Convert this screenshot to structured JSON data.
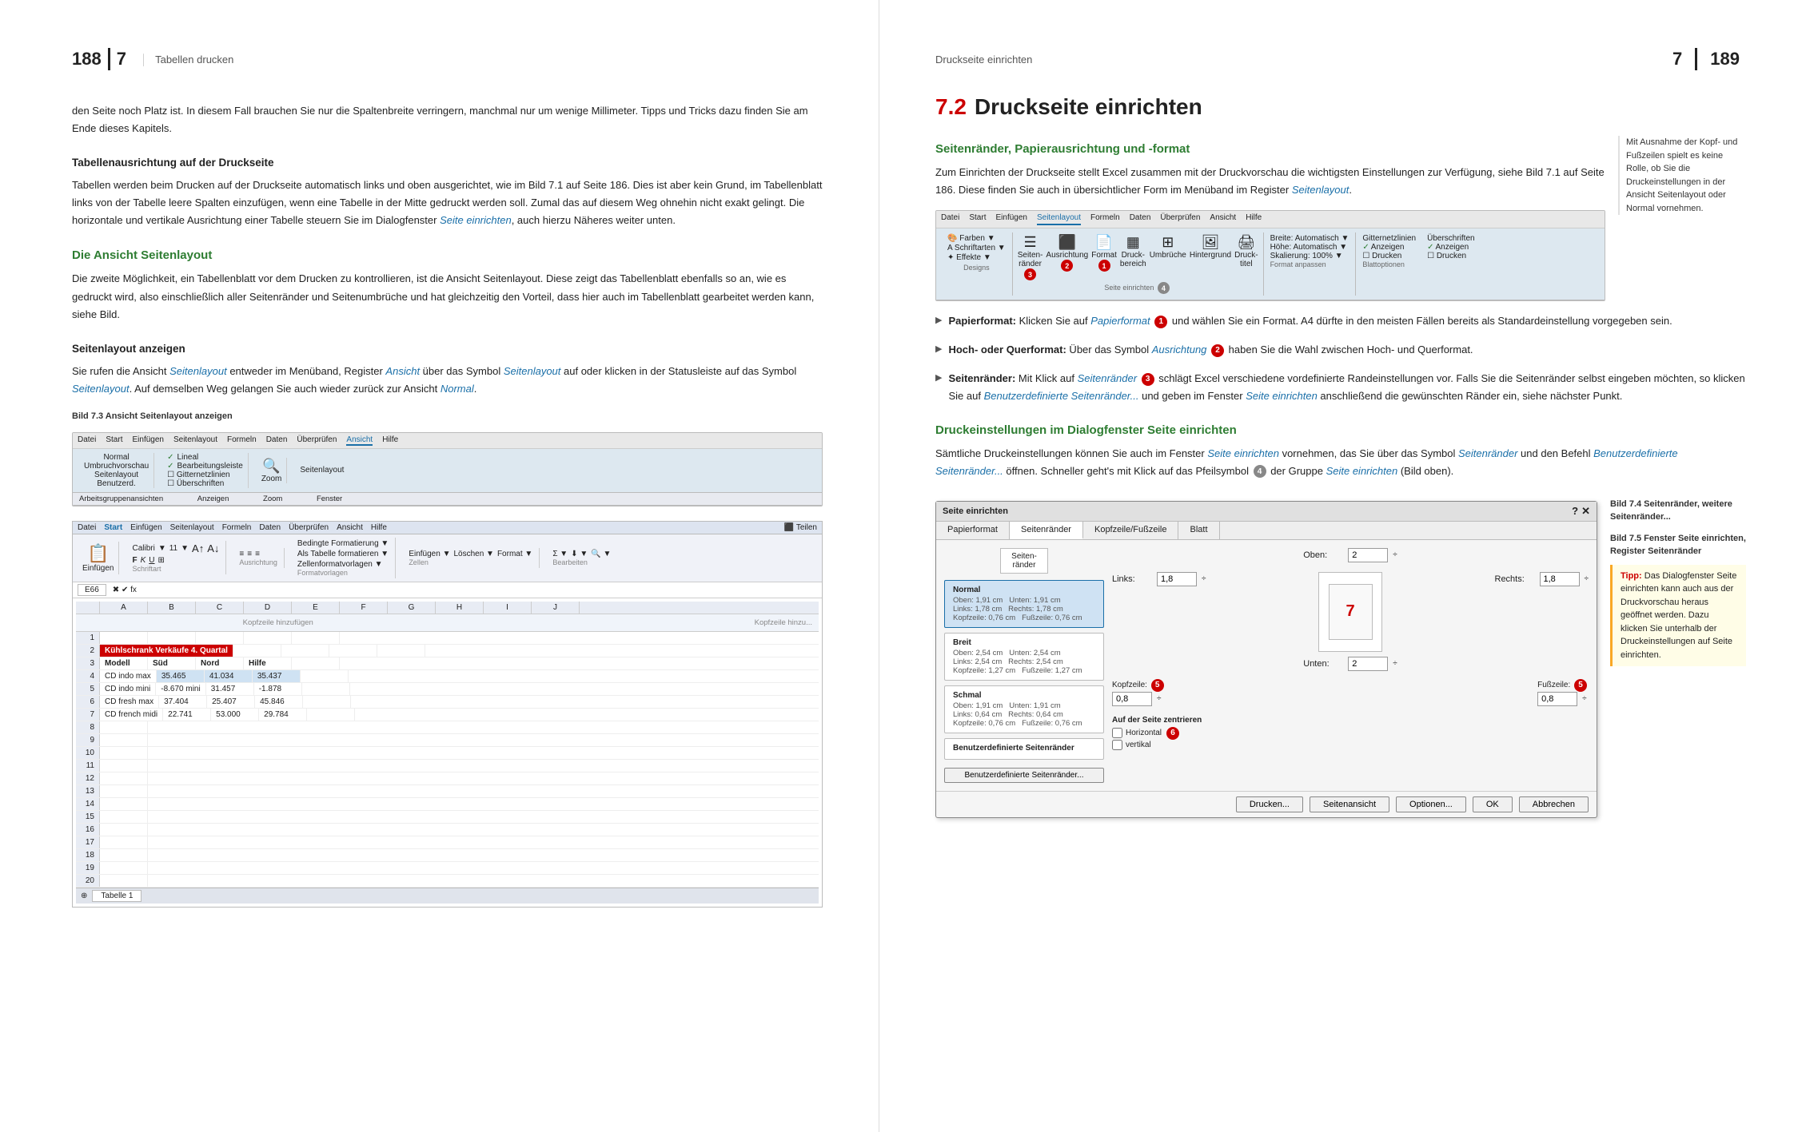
{
  "left": {
    "page_num": "188",
    "chapter_num": "7",
    "chapter_title": "Tabellen drucken",
    "intro_text": "den Seite noch Platz ist. In diesem Fall brauchen Sie nur die Spaltenbreite verringern, manchmal nur um wenige Millimeter. Tipps und Tricks dazu finden Sie am Ende dieses Kapitels.",
    "section1_heading": "Tabellenausrichtung auf der Druckseite",
    "section1_text": "Tabellen werden beim Drucken auf der Druckseite automatisch links und oben ausgerichtet, wie im Bild 7.1 auf Seite 186. Dies ist aber kein Grund, im Tabellenblatt links von der Tabelle leere Spalten einzufügen, wenn eine Tabelle in der Mitte gedruckt werden soll. Zumal das auf diesem Weg ohnehin nicht exakt gelingt. Die horizontale und vertikale Ausrichtung einer Tabelle steuern Sie im Dialogfenster Seite einrichten, auch hierzu Näheres weiter unten.",
    "section1_link": "Seite einrichten",
    "section2_heading": "Die Ansicht Seitenlayout",
    "section2_text": "Die zweite Möglichkeit, ein Tabellenblatt vor dem Drucken zu kontrollieren, ist die Ansicht Seitenlayout. Diese zeigt das Tabellenblatt ebenfalls so an, wie es gedruckt wird, also einschließlich aller Seitenränder und Seitenumbrüche und hat gleichzeitig den Vorteil, dass hier auch im Tabellenblatt gearbeitet werden kann, siehe Bild.",
    "section3_heading": "Seitenlayout anzeigen",
    "section3_text": "Sie rufen die Ansicht Seitenlayout entweder im Menüband, Register Ansicht über das Symbol Seitenlayout auf oder klicken in der Statusleiste auf das Symbol Seitenlayout. Auf demselben Weg gelangen Sie auch wieder zurück zur Ansicht Normal.",
    "section3_links": [
      "Seitenlayout",
      "Ansicht",
      "Seitenlayout",
      "Seitenlayout",
      "Normal"
    ],
    "caption1": "Bild 7.3 Ansicht Seitenlayout anzeigen",
    "ribbon_tabs1": [
      "Datei",
      "Start",
      "Einfügen",
      "Seitenlayout",
      "Formeln",
      "Daten",
      "Überprüfen",
      "Ansicht",
      "Hilfe"
    ],
    "ribbon_active1": "Ansicht",
    "ribbon_items1": [
      "Normal",
      "Umbruchvorschau",
      "Seitenlayout",
      "Benutzerd.",
      "Lineal",
      "Gitternetzlinien",
      "Überschriften",
      "Anzeigen",
      "Zoom"
    ],
    "ribbon_tabs2": [
      "Datei",
      "Start",
      "Einfügen",
      "Seitenlayout",
      "Formeln",
      "Daten",
      "Überprüfen",
      "Ansicht",
      "Hilfe",
      "Teilen"
    ],
    "ribbon_items2_left": [
      "Einfügen",
      "Calibri",
      "11",
      "F",
      "K",
      "U"
    ],
    "table_title": "Kühlschrank Verkäufe 4. Quartal",
    "table_headers": [
      "Modell",
      "Süd",
      "Nord",
      "Hilfe"
    ],
    "table_rows": [
      [
        "CD indo max",
        "35.465",
        "41.034",
        "35.437"
      ],
      [
        "CD indo mini",
        "-8.670 mini",
        "31.457",
        "-1.878"
      ],
      [
        "CD fresh max",
        "37.404",
        "25.407",
        "45.846"
      ],
      [
        "CD french midi",
        "22.741",
        "53.000",
        "29.784"
      ]
    ]
  },
  "right": {
    "page_num": "189",
    "chapter_num": "7",
    "chapter_title": "Druckseite einrichten",
    "section_num": "7.2",
    "section_title": "Druckseite einrichten",
    "sub1_heading": "Seitenränder, Papierausrichtung und -format",
    "sub1_text": "Zum Einrichten der Druckseite stellt Excel zusammen mit der Druckvorschau die wichtigsten Einstellungen zur Verfügung, siehe Bild 7.1 auf Seite 186. Diese finden Sie auch in übersichtlicher Form im Menüband im Register Seitenlayout.",
    "sub1_link": "Seitenlayout",
    "ribbon_tabs": [
      "Datei",
      "Start",
      "Einfügen",
      "Seitenlayout",
      "Formeln",
      "Daten",
      "Überprüfen",
      "Ansicht",
      "Hilfe"
    ],
    "ribbon_active": "Seitenlayout",
    "ribbon_groups": [
      {
        "label": "Designs",
        "items": [
          "Farben",
          "Schriftarten",
          "Effekte"
        ]
      },
      {
        "label": "",
        "items": [
          "Seiten-ränder",
          "Ausrichtung",
          "Format",
          "Druck-bereich",
          "Umbrüche",
          "Hintergrund",
          "Druck-titel"
        ]
      },
      {
        "label": "Seite einrichten",
        "items": []
      },
      {
        "label": "",
        "items": [
          "Breite: Automatisch",
          "Höhe: Automatisch",
          "Skalierung: 100%"
        ]
      },
      {
        "label": "Format anpassen",
        "items": []
      },
      {
        "label": "",
        "items": [
          "Gitternetzlinien",
          "Überschriften",
          "Anzeigen",
          "Anzeigen",
          "Drucken",
          "Drucken"
        ]
      },
      {
        "label": "Blattoptionen",
        "items": []
      }
    ],
    "bullet1_label": "Papierformat:",
    "bullet1_text": "Klicken Sie auf Papierformat und wählen Sie ein Format. A4 dürfte in den meisten Fällen bereits als Standardeinstellung vorgegeben sein.",
    "bullet1_link": "Papierformat",
    "bullet1_circle": "1",
    "bullet2_label": "Hoch- oder Querformat:",
    "bullet2_text": "Über das Symbol Ausrichtung haben Sie die Wahl zwischen Hoch- und Querformat.",
    "bullet2_link": "Ausrichtung",
    "bullet2_circle": "2",
    "bullet3_label": "Seitenränder:",
    "bullet3_text": "Mit Klick auf Seitenränder schlägt Excel verschiedene vordefinierte Randeinstellungen vor. Falls Sie die Seitenränder selbst eingeben möchten, so klicken Sie auf Benutzerdefinierte Seitenränder... und geben im Fenster Seite einrichten anschließend die gewünschten Ränder ein, siehe nächster Punkt.",
    "bullet3_links": [
      "Seitenränder",
      "Benutzerdefinierte Seitenränder...",
      "Seite einrichten"
    ],
    "bullet3_circle": "3",
    "sub2_heading": "Druckeinstellungen im Dialogfenster Seite einrichten",
    "sub2_text": "Sämtliche Druckeinstellungen können Sie auch im Fenster Seite einrichten vornehmen, das Sie über das Symbol Seitenränder und den Befehl Benutzerdefinierte Seitenränder... öffnen. Schneller geht's mit Klick auf das Pfeilsymbol der Gruppe Seite einrichten (Bild oben).",
    "sub2_links": [
      "Seite einrichten",
      "Seitenränder",
      "Benutzerdefinierte Seitenränder...",
      "Seite einrichten"
    ],
    "sub2_circle4": "4",
    "dialog_title": "Seite einrichten",
    "dialog_tabs": [
      "Papierformat",
      "Seitenränder",
      "Kopfzeile/Fußzeile",
      "Blatt"
    ],
    "dialog_active_tab": "Seitenränder",
    "margin_options": [
      {
        "label": "Normal",
        "vals": "Oben: 1,91 cm  Unten: 1,91 cm\nLinks: 1,78 cm  Rechts: 1,78 cm\nKopfzeile: 0,76 cm  Fußzeile: 0,76 cm"
      },
      {
        "label": "Breit",
        "vals": "Oben: 2,54 cm  Unten: 2,54 cm\nLinks: 2,54 cm  Rechts: 2,54 cm\nKopfzeile: 1,27 cm  Fußzeile: 1,27 cm"
      },
      {
        "label": "Schmal",
        "vals": "Oben: 1,91 cm  Unten: 1,91 cm\nLinks: 0,64 cm  Rechts: 0,64 cm\nKopfzeile: 0,76 cm  Fußzeile: 0,76 cm"
      }
    ],
    "margin_custom_label": "Benutzerdefinierte Seitenränder",
    "margin_custom_btn": "Benutzerdefinierte Seitenränder...",
    "dialog_right_oben_label": "Oben:",
    "dialog_right_oben_val": "2",
    "dialog_right_kopfzeile_label": "Kopfzeile:",
    "dialog_right_kopfzeile_val": "0,8",
    "dialog_right_links_label": "Links:",
    "dialog_right_links_val": "1,8",
    "dialog_right_rechts_label": "Rechts:",
    "dialog_right_rechts_val": "1,8",
    "dialog_right_unten_label": "Unten:",
    "dialog_right_unten_val": "2",
    "dialog_right_fusszeile_label": "Fußzeile:",
    "dialog_right_fusszeile_val": "0,8",
    "dialog_center_label": "Auf der Seite zentrieren",
    "dialog_center_horiz": "Horizontal",
    "dialog_center_vert": "vertikal",
    "dialog_circles": [
      "5",
      "5",
      "6",
      "7"
    ],
    "dialog_btns": [
      "Drucken...",
      "Seitenansicht",
      "Optionen..."
    ],
    "dialog_ok": "OK",
    "dialog_cancel": "Abbrechen",
    "side_note1": "Mit Ausnahme der Kopf- und Fußzeilen spielt es keine Rolle, ob Sie die Druckeinstellungen in der Ansicht Seitenlayout oder Normal vornehmen.",
    "caption2_bold": "Bild 7.4 Seitenränder, weitere Seitenränder...",
    "caption3_bold": "Bild 7.5 Fenster Seite einrichten, Register Seitenränder",
    "tip_label": "Tipp:",
    "tip_text": "Das Dialogfenster Seite einrichten kann auch aus der Druckvorschau heraus geöffnet werden. Dazu klicken Sie unterhalb der Druckeinstellungen auf Seite einrichten."
  }
}
